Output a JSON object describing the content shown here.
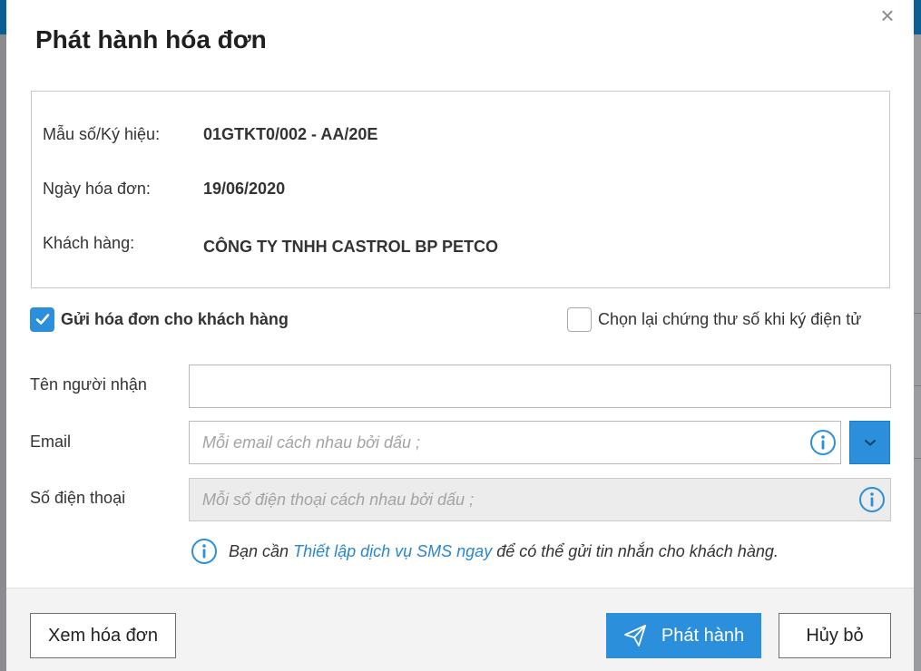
{
  "dialog": {
    "title": "Phát hành hóa đơn",
    "close_icon": "×"
  },
  "invoice_info": {
    "rows": [
      {
        "label": "Mẫu số/Ký hiệu:",
        "value": "01GTKT0/002 - AA/20E"
      },
      {
        "label": "Ngày hóa đơn:",
        "value": "19/06/2020"
      },
      {
        "label": "Khách hàng:",
        "value": "CÔNG TY TNHH CASTROL BP PETCO"
      }
    ]
  },
  "options": {
    "send_to_customer": {
      "label": "Gửi hóa đơn cho khách hàng",
      "checked": true
    },
    "reselect_certificate": {
      "label": "Chọn lại chứng thư số khi ký điện tử",
      "checked": false
    }
  },
  "form": {
    "recipient_name": {
      "label": "Tên người nhận",
      "value": ""
    },
    "email": {
      "label": "Email",
      "placeholder": "Mỗi email cách nhau bởi dấu ;",
      "value": ""
    },
    "phone": {
      "label": "Số điện thoại",
      "placeholder": "Mỗi số điện thoại cách nhau bởi dấu ;",
      "value": "",
      "disabled": true
    }
  },
  "sms_note": {
    "prefix": "Bạn cần",
    "link": "Thiết lập dịch vụ SMS ngay",
    "suffix": "để có thể gửi tin nhắn cho khách hàng."
  },
  "footer": {
    "view_invoice": "Xem hóa đơn",
    "issue": "Phát hành",
    "cancel": "Hủy bỏ"
  },
  "colors": {
    "accent": "#2b8fdc",
    "link": "#2a86cc",
    "background_header": "#0b5f94"
  },
  "icons": {
    "close": "close-icon",
    "check": "check-icon",
    "info": "info-icon",
    "dropdown": "chevron-down-icon",
    "send": "paper-plane-icon"
  }
}
